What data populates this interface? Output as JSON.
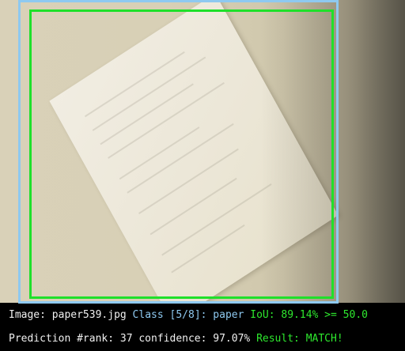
{
  "info": {
    "image_label": "Image:",
    "image_name": "paper539.jpg",
    "class_label": "Class [5/8]: paper",
    "iou_text": "IoU: 89.14% >= 50.0",
    "prediction_text": "Prediction #rank: 37 confidence: 97.07%",
    "result_text": "Result: MATCH!"
  },
  "colors": {
    "ground_truth_box": "#8ec9f0",
    "prediction_box": "#1fe02a",
    "text_white": "#f0f0f0",
    "text_blue": "#8ec9f0",
    "text_green": "#2ee82e"
  }
}
